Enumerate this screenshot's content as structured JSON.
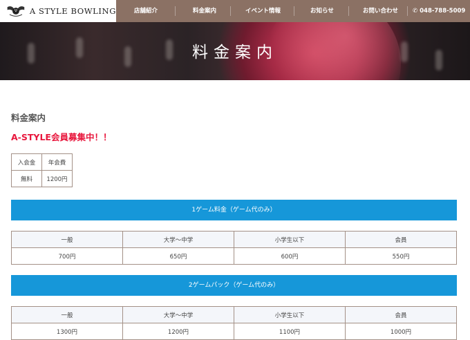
{
  "brand": {
    "name": "A STYLE BOWLING"
  },
  "nav": {
    "items": [
      "店舗紹介",
      "料金案内",
      "イベント情報",
      "お知らせ",
      "お問い合わせ"
    ],
    "phone": "048-788-5009"
  },
  "icons": {
    "logo": "bowling-emblem-icon",
    "phone": "phone-icon"
  },
  "hero": {
    "title": "料金案内"
  },
  "main": {
    "heading": "料金案内",
    "campaign": "A-STYLE会員募集中！！",
    "fee_table": {
      "headers": [
        "入会金",
        "年会費"
      ],
      "values": [
        "無料",
        "1200円"
      ]
    },
    "sections": [
      {
        "title": "1ゲーム料金（ゲーム代のみ）",
        "headers": [
          "一般",
          "大学〜中学",
          "小学生以下",
          "会員"
        ],
        "values": [
          "700円",
          "650円",
          "600円",
          "550円"
        ]
      },
      {
        "title": "2ゲームパック（ゲーム代のみ）",
        "headers": [
          "一般",
          "大学〜中学",
          "小学生以下",
          "会員"
        ],
        "values": [
          "1300円",
          "1200円",
          "1100円",
          "1000円"
        ]
      }
    ]
  },
  "colors": {
    "header": "#8b7164",
    "section_bar": "#1697d9",
    "campaign": "#e8173d",
    "table_border": "#a39086"
  }
}
